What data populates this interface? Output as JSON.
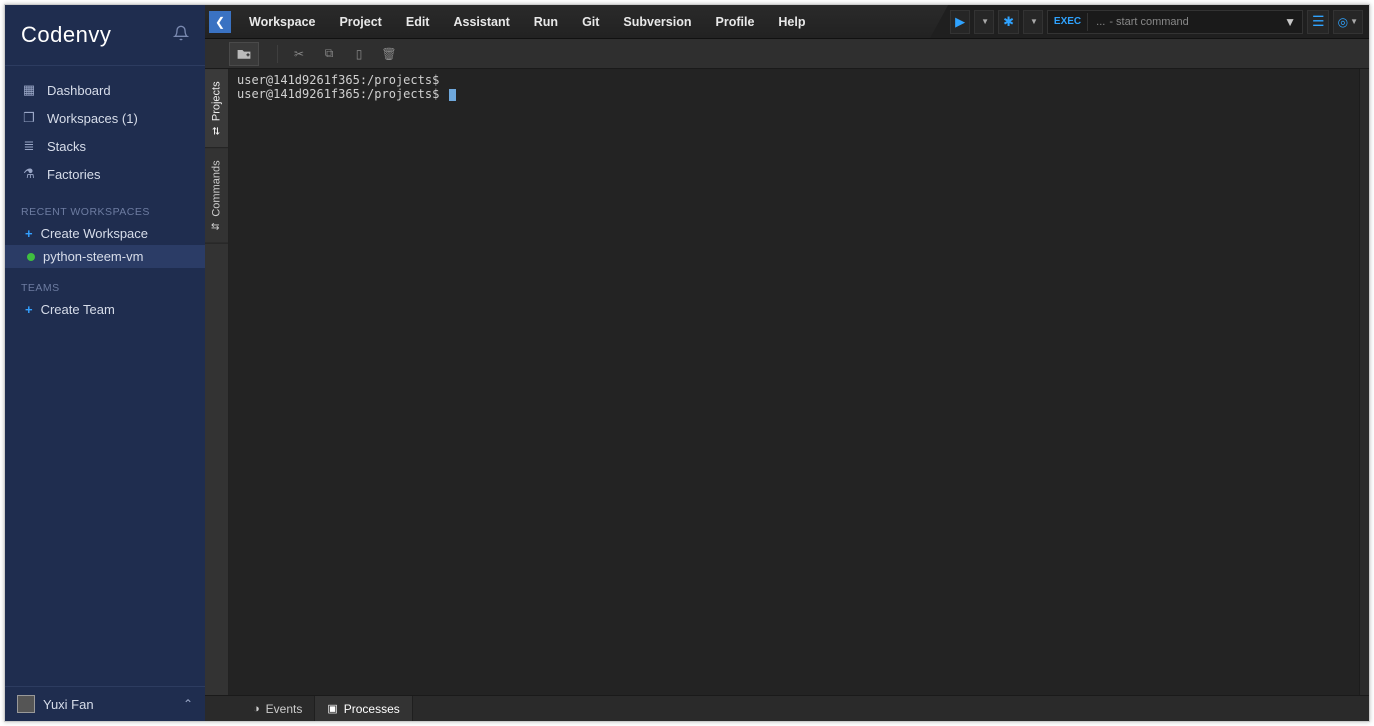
{
  "brand": "Codenvy",
  "sidebar": {
    "nav": [
      {
        "label": "Dashboard",
        "icon": "▦"
      },
      {
        "label": "Workspaces (1)",
        "icon": "❒"
      },
      {
        "label": "Stacks",
        "icon": "≣"
      },
      {
        "label": "Factories",
        "icon": "⚗"
      }
    ],
    "recent_header": "RECENT WORKSPACES",
    "create_workspace": "Create Workspace",
    "workspace_name": "python-steem-vm",
    "teams_header": "TEAMS",
    "create_team": "Create Team",
    "user": "Yuxi Fan"
  },
  "menubar": [
    "Workspace",
    "Project",
    "Edit",
    "Assistant",
    "Run",
    "Git",
    "Subversion",
    "Profile",
    "Help"
  ],
  "exec": {
    "label": "EXEC",
    "placeholder": "- start command",
    "prefix": "..."
  },
  "terminal": {
    "lines": [
      "user@141d9261f365:/projects$",
      "user@141d9261f365:/projects$ "
    ]
  },
  "vtabs": {
    "projects": "Projects",
    "commands": "Commands"
  },
  "bottom": {
    "events": "Events",
    "processes": "Processes"
  }
}
